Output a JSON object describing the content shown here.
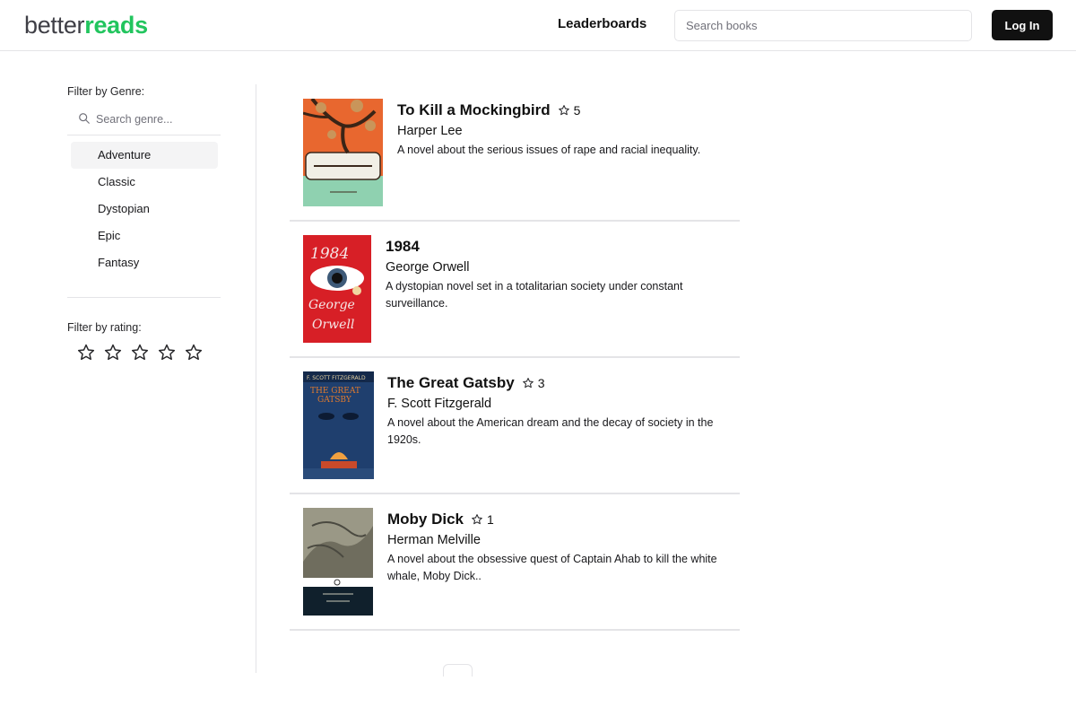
{
  "header": {
    "logo_light": "better",
    "logo_bold": "reads",
    "nav_leaderboards": "Leaderboards",
    "search_placeholder": "Search books",
    "login_label": "Log In"
  },
  "sidebar": {
    "genre_filter_label": "Filter by Genre:",
    "genre_search_placeholder": "Search genre...",
    "genres": [
      "Adventure",
      "Classic",
      "Dystopian",
      "Epic",
      "Fantasy"
    ],
    "selected_genre": "Adventure",
    "rating_filter_label": "Filter by rating:",
    "rating_star_count": 5
  },
  "books": [
    {
      "title": "To Kill a Mockingbird",
      "rating": "5",
      "author": "Harper Lee",
      "description": "A novel about the serious issues of rape and racial inequality."
    },
    {
      "title": "1984",
      "rating": "",
      "author": "George Orwell",
      "description": "A dystopian novel set in a totalitarian society under constant surveillance."
    },
    {
      "title": "The Great Gatsby",
      "rating": "3",
      "author": "F. Scott Fitzgerald",
      "description": "A novel about the American dream and the decay of society in the 1920s."
    },
    {
      "title": "Moby Dick",
      "rating": "1",
      "author": "Herman Melville",
      "description": "A novel about the obsessive quest of Captain Ahab to kill the white whale, Moby Dick.."
    }
  ],
  "colors": {
    "brand_green": "#22c55e",
    "button_dark": "#111111",
    "border": "#e4e4e7",
    "selected_bg": "#f4f4f5"
  }
}
